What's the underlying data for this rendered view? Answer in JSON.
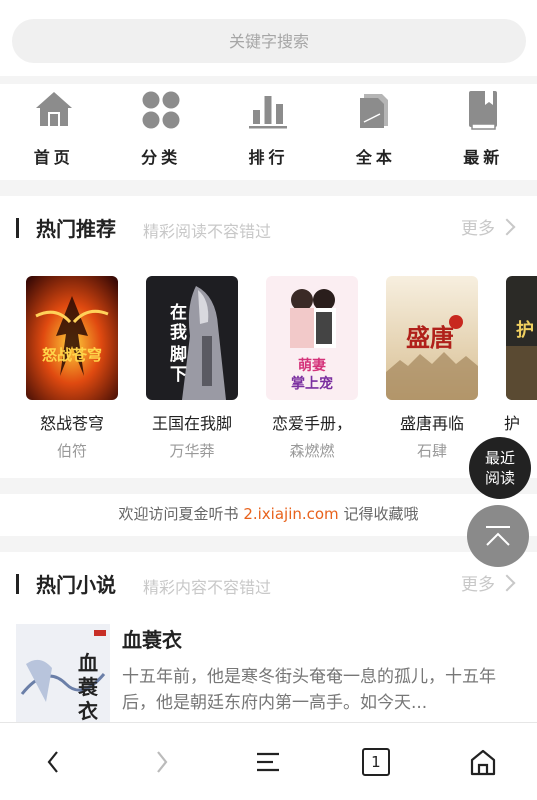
{
  "search": {
    "placeholder": "关键字搜索"
  },
  "nav": {
    "items": [
      {
        "label": "首页",
        "icon": "home-icon"
      },
      {
        "label": "分类",
        "icon": "category-icon"
      },
      {
        "label": "排行",
        "icon": "ranking-icon"
      },
      {
        "label": "全本",
        "icon": "complete-books-icon"
      },
      {
        "label": "最新",
        "icon": "latest-book-icon"
      }
    ]
  },
  "hot_recommend": {
    "title": "热门推荐",
    "subtitle": "精彩阅读不容错过",
    "more": "更多",
    "books": [
      {
        "title": "怒战苍穹",
        "author": "伯符"
      },
      {
        "title": "王国在我脚",
        "author": "万华莽"
      },
      {
        "title": "恋爱手册，",
        "author": "森燃燃"
      },
      {
        "title": "盛唐再临",
        "author": "石肆"
      },
      {
        "title": "护",
        "author": ""
      }
    ]
  },
  "visit": {
    "prefix": "欢迎访问夏金听书 ",
    "link": "2.ixiajin.com",
    "suffix": " 记得收藏哦"
  },
  "hot_novels": {
    "title": "热门小说",
    "subtitle": "精彩内容不容错过",
    "more": "更多",
    "items": [
      {
        "title": "血蓑衣",
        "desc": "十五年前，他是寒冬街头奄奄一息的孤儿，十五年后，他是朝廷东府内第一高手。如今天..."
      }
    ]
  },
  "floating": {
    "recent_line1": "最近",
    "recent_line2": "阅读"
  },
  "bottom_bar": {
    "page_count": "1"
  },
  "colors": {
    "accent": "#e8621c",
    "text_dark": "#222222",
    "muted": "#999999"
  }
}
